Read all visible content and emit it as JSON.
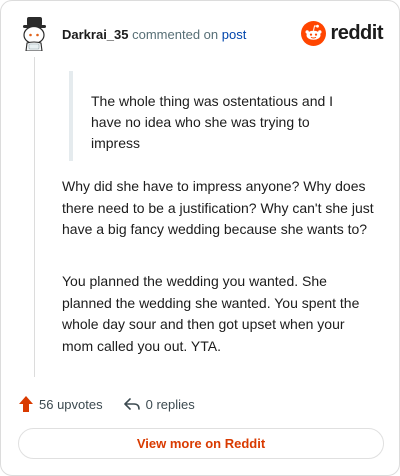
{
  "header": {
    "author": "Darkrai_35",
    "commented_on": "commented on",
    "post_link": "post",
    "brand": "reddit"
  },
  "comment": {
    "quote": "The whole thing was ostentatious and I have no idea who she was trying to impress",
    "paragraphs": [
      "Why did she have to impress anyone? Why does there need to be a justification? Why can't she just have a big fancy wedding because she wants to?",
      "You planned the wedding you wanted. She planned the wedding she wanted. You spent the whole day sour and then got upset when your mom called you out. YTA."
    ]
  },
  "actions": {
    "upvotes": "56 upvotes",
    "replies": "0 replies"
  },
  "view_more_label": "View more on Reddit",
  "colors": {
    "brand_orange": "#ff4500",
    "upvote_orange": "#d93a00",
    "link_blue": "#0045ac",
    "muted_text": "#576f76"
  }
}
